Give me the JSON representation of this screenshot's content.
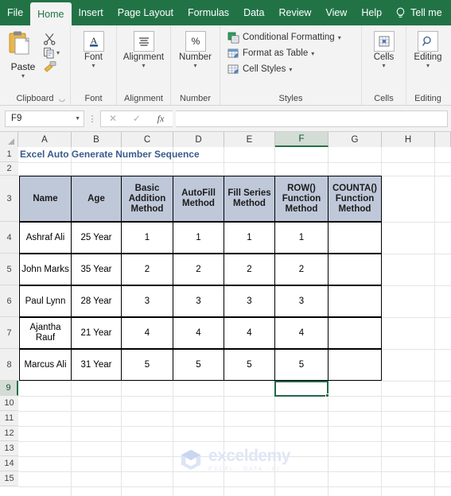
{
  "ribbon": {
    "tabs": [
      {
        "label": "File",
        "active": false
      },
      {
        "label": "Home",
        "active": true
      },
      {
        "label": "Insert",
        "active": false
      },
      {
        "label": "Page Layout",
        "active": false
      },
      {
        "label": "Formulas",
        "active": false
      },
      {
        "label": "Data",
        "active": false
      },
      {
        "label": "Review",
        "active": false
      },
      {
        "label": "View",
        "active": false
      },
      {
        "label": "Help",
        "active": false
      }
    ],
    "tell_me": "Tell me",
    "groups": {
      "clipboard": {
        "label": "Clipboard",
        "paste": "Paste",
        "cut_icon": "scissors-icon",
        "copy_icon": "copy-icon",
        "format_painter_icon": "format-painter-icon"
      },
      "font": {
        "label": "Font",
        "button": "Font",
        "icon": "font-a-icon"
      },
      "alignment": {
        "label": "Alignment",
        "button": "Alignment",
        "icon": "align-lines-icon"
      },
      "number": {
        "label": "Number",
        "button": "Number",
        "icon": "percent-icon"
      },
      "styles": {
        "label": "Styles",
        "items": [
          {
            "label": "Conditional Formatting",
            "icon": "conditional-formatting-icon"
          },
          {
            "label": "Format as Table",
            "icon": "format-as-table-icon"
          },
          {
            "label": "Cell Styles",
            "icon": "cell-styles-icon"
          }
        ]
      },
      "cells": {
        "label": "Cells",
        "button": "Cells",
        "icon": "cells-grid-icon"
      },
      "editing": {
        "label": "Editing",
        "button": "Editing",
        "icon": "magnifier-icon"
      }
    }
  },
  "formula_bar": {
    "name_box_value": "F9",
    "cancel_icon": "cancel-x-icon",
    "enter_icon": "confirm-check-icon",
    "fx_icon": "insert-function-icon",
    "formula_value": ""
  },
  "sheet": {
    "column_headers": [
      "A",
      "B",
      "C",
      "D",
      "E",
      "F",
      "G",
      "H"
    ],
    "selected_column": "F",
    "row_headers": [
      "1",
      "2",
      "3",
      "4",
      "5",
      "6",
      "7",
      "8",
      "9",
      "10",
      "11",
      "12",
      "13",
      "14",
      "15"
    ],
    "selected_row": "9",
    "selected_cell": "F9",
    "title": "Excel Auto Generate Number Sequence",
    "table_headers": [
      "Name",
      "Age",
      "Basic Addition Method",
      "AutoFill Method",
      "Fill Series Method",
      "ROW() Function Method",
      "COUNTA() Function Method"
    ],
    "rows": [
      [
        "Ashraf Ali",
        "25 Year",
        "1",
        "1",
        "1",
        "1",
        ""
      ],
      [
        "John Marks",
        "35 Year",
        "2",
        "2",
        "2",
        "2",
        ""
      ],
      [
        "Paul Lynn",
        "28 Year",
        "3",
        "3",
        "3",
        "3",
        ""
      ],
      [
        "Ajantha Rauf",
        "21 Year",
        "4",
        "4",
        "4",
        "4",
        ""
      ],
      [
        "Marcus Ali",
        "31 Year",
        "5",
        "5",
        "5",
        "5",
        ""
      ]
    ]
  },
  "watermark": {
    "brand": "exceldemy",
    "tagline": "EXCEL - DATA - BI",
    "logo_icon": "exceldemy-cube-logo-icon"
  },
  "colors": {
    "ribbon_green": "#217346",
    "header_fill": "#bfc8d9",
    "title_text": "#3a5a8c",
    "selection_green": "#21684a"
  }
}
